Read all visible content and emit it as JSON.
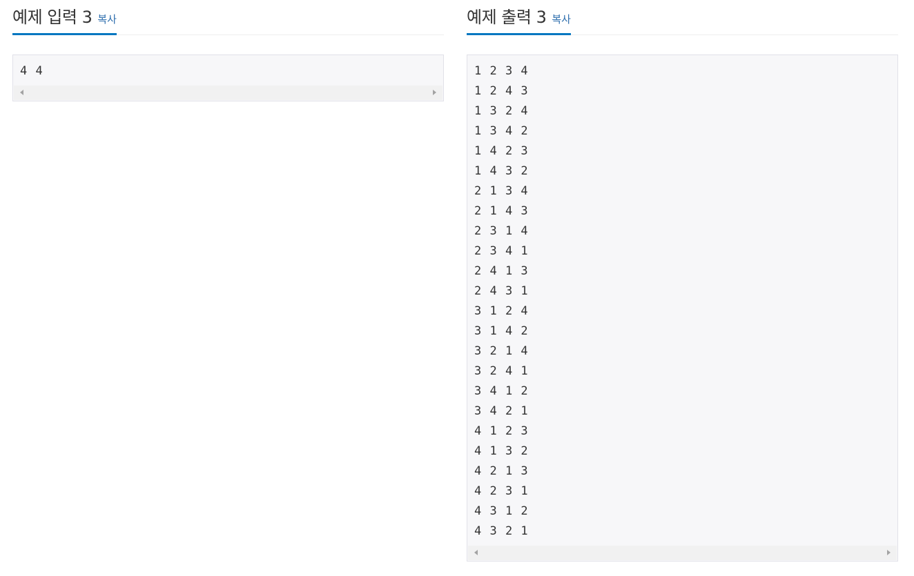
{
  "input_section": {
    "title": "예제 입력 3",
    "copy_label": "복사",
    "content": "4 4"
  },
  "output_section": {
    "title": "예제 출력 3",
    "copy_label": "복사",
    "content": "1 2 3 4\n1 2 4 3\n1 3 2 4\n1 3 4 2\n1 4 2 3\n1 4 3 2\n2 1 3 4\n2 1 4 3\n2 3 1 4\n2 3 4 1\n2 4 1 3\n2 4 3 1\n3 1 2 4\n3 1 4 2\n3 2 1 4\n3 2 4 1\n3 4 1 2\n3 4 2 1\n4 1 2 3\n4 1 3 2\n4 2 1 3\n4 2 3 1\n4 3 1 2\n4 3 2 1"
  },
  "colors": {
    "accent": "#0076c0",
    "link": "#2f6fae",
    "pre_background": "#f7f7f9",
    "pre_border": "#e1e1e8"
  }
}
